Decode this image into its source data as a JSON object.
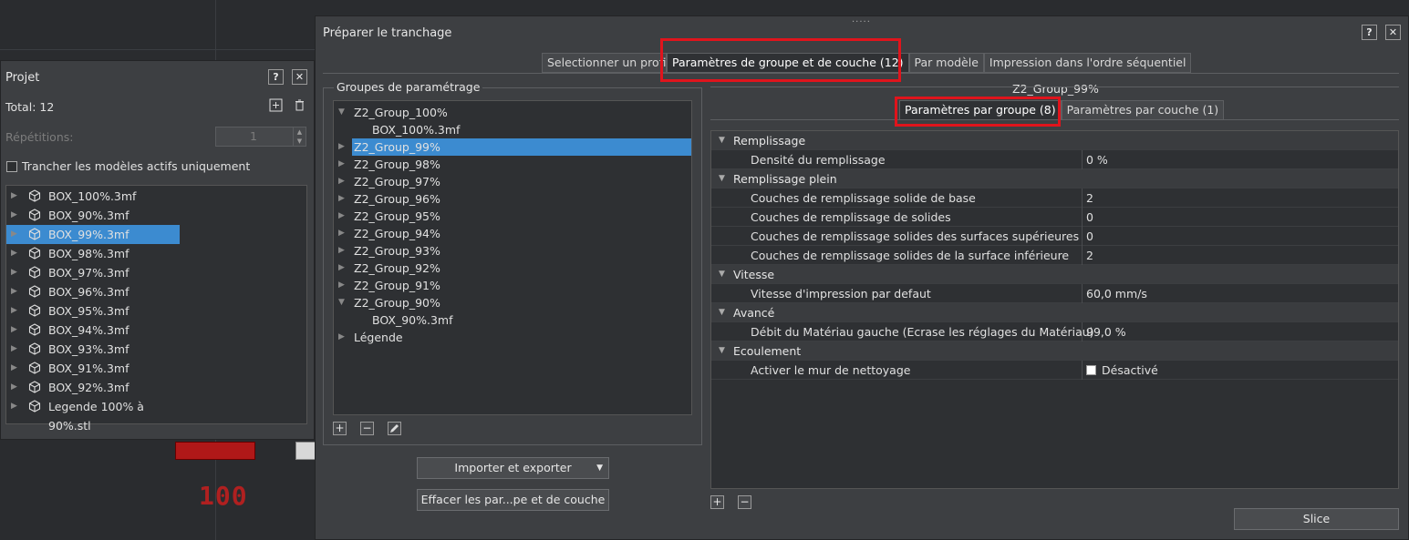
{
  "colors": {
    "selection": "#3c8bd0",
    "highlight": "#e0141c"
  },
  "viewport": {
    "model_label": "100"
  },
  "projet": {
    "title": "Projet",
    "help": "?",
    "close": "✕",
    "total": "Total: 12",
    "repetitions_label": "Répétitions:",
    "repetitions_value": "1",
    "checkbox_label": "Trancher les modèles actifs uniquement",
    "models": [
      "BOX_100%.3mf",
      "BOX_90%.3mf",
      "BOX_99%.3mf",
      "BOX_98%.3mf",
      "BOX_97%.3mf",
      "BOX_96%.3mf",
      "BOX_95%.3mf",
      "BOX_94%.3mf",
      "BOX_93%.3mf",
      "BOX_91%.3mf",
      "BOX_92%.3mf",
      "Legende 100% à 90%.stl"
    ]
  },
  "dialog": {
    "title": "Préparer le tranchage",
    "help": "?",
    "close": "✕",
    "tabs": [
      "Selectionner un profi",
      "Paramètres de groupe et de couche (12)",
      "Par modèle",
      "Impression dans l'ordre séquentiel"
    ],
    "groups_title": "Groupes de paramétrage",
    "groups": [
      {
        "label": "Z2_Group_100%",
        "expanded": true
      },
      {
        "label": "BOX_100%.3mf",
        "child": true
      },
      {
        "label": "Z2_Group_99%",
        "selected": true
      },
      {
        "label": "Z2_Group_98%"
      },
      {
        "label": "Z2_Group_97%"
      },
      {
        "label": "Z2_Group_96%"
      },
      {
        "label": "Z2_Group_95%"
      },
      {
        "label": "Z2_Group_94%"
      },
      {
        "label": "Z2_Group_93%"
      },
      {
        "label": "Z2_Group_92%"
      },
      {
        "label": "Z2_Group_91%"
      },
      {
        "label": "Z2_Group_90%",
        "expanded": true
      },
      {
        "label": "BOX_90%.3mf",
        "child": true
      },
      {
        "label": "Légende"
      }
    ],
    "import_export": "Importer et exporter",
    "clear_button": "Effacer les par...pe et de couche",
    "group_name": "Z2_Group_99%",
    "subtabs": [
      "Paramètres par groupe (8)",
      "Paramètres par couche (1)"
    ],
    "properties": [
      {
        "category": "Remplissage"
      },
      {
        "name": "Densité du remplissage",
        "value": "0 %"
      },
      {
        "category": "Remplissage plein"
      },
      {
        "name": "Couches de remplissage solide de base",
        "value": "2"
      },
      {
        "name": "Couches de remplissage de solides",
        "value": "0"
      },
      {
        "name": "Couches de remplissage solides des surfaces supérieures",
        "value": "0"
      },
      {
        "name": "Couches de remplissage solides de la surface inférieure",
        "value": "2"
      },
      {
        "category": "Vitesse"
      },
      {
        "name": "Vitesse d'impression par defaut",
        "value": "60,0 mm/s"
      },
      {
        "category": "Avancé"
      },
      {
        "name": "Débit du Matériau gauche (Ecrase les réglages du Matériau)",
        "value": "99,0 %"
      },
      {
        "category": "Ecoulement"
      },
      {
        "name": "Activer le mur de nettoyage",
        "value": "Désactivé",
        "checkbox": true
      }
    ],
    "slice": "Slice"
  }
}
